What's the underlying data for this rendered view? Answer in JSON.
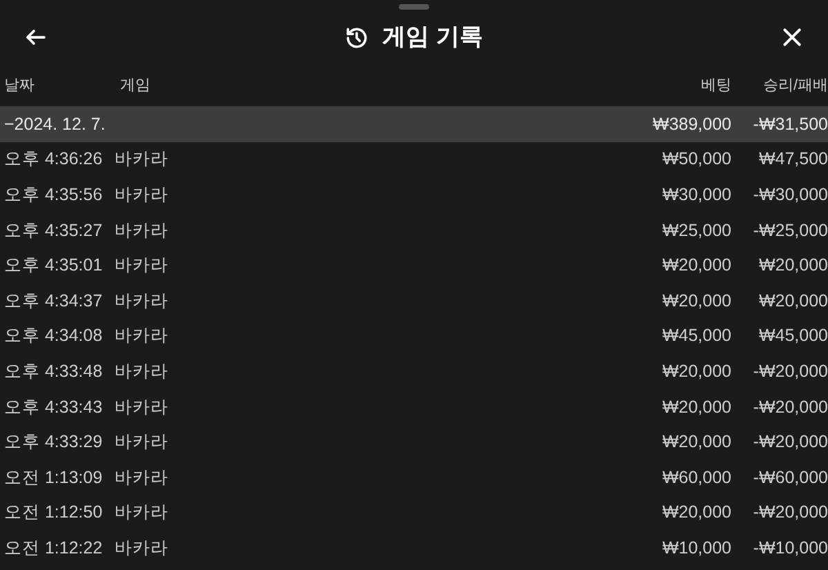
{
  "header": {
    "title": "게임 기록"
  },
  "table": {
    "columns": [
      "날짜",
      "게임",
      "베팅",
      "승리/패배"
    ],
    "group": {
      "label": "−2024. 12. 7.",
      "bet": "₩389,000",
      "result": "-₩31,500"
    },
    "rows": [
      {
        "date": "오후 4:36:26",
        "game": "바카라",
        "bet": "₩50,000",
        "result": "₩47,500"
      },
      {
        "date": "오후 4:35:56",
        "game": "바카라",
        "bet": "₩30,000",
        "result": "-₩30,000"
      },
      {
        "date": "오후 4:35:27",
        "game": "바카라",
        "bet": "₩25,000",
        "result": "-₩25,000"
      },
      {
        "date": "오후 4:35:01",
        "game": "바카라",
        "bet": "₩20,000",
        "result": "₩20,000"
      },
      {
        "date": "오후 4:34:37",
        "game": "바카라",
        "bet": "₩20,000",
        "result": "₩20,000"
      },
      {
        "date": "오후 4:34:08",
        "game": "바카라",
        "bet": "₩45,000",
        "result": "₩45,000"
      },
      {
        "date": "오후 4:33:48",
        "game": "바카라",
        "bet": "₩20,000",
        "result": "-₩20,000"
      },
      {
        "date": "오후 4:33:43",
        "game": "바카라",
        "bet": "₩20,000",
        "result": "-₩20,000"
      },
      {
        "date": "오후 4:33:29",
        "game": "바카라",
        "bet": "₩20,000",
        "result": "-₩20,000"
      },
      {
        "date": "오전 1:13:09",
        "game": "바카라",
        "bet": "₩60,000",
        "result": "-₩60,000"
      },
      {
        "date": "오전 1:12:50",
        "game": "바카라",
        "bet": "₩20,000",
        "result": "-₩20,000"
      },
      {
        "date": "오전 1:12:22",
        "game": "바카라",
        "bet": "₩10,000",
        "result": "-₩10,000"
      }
    ]
  }
}
